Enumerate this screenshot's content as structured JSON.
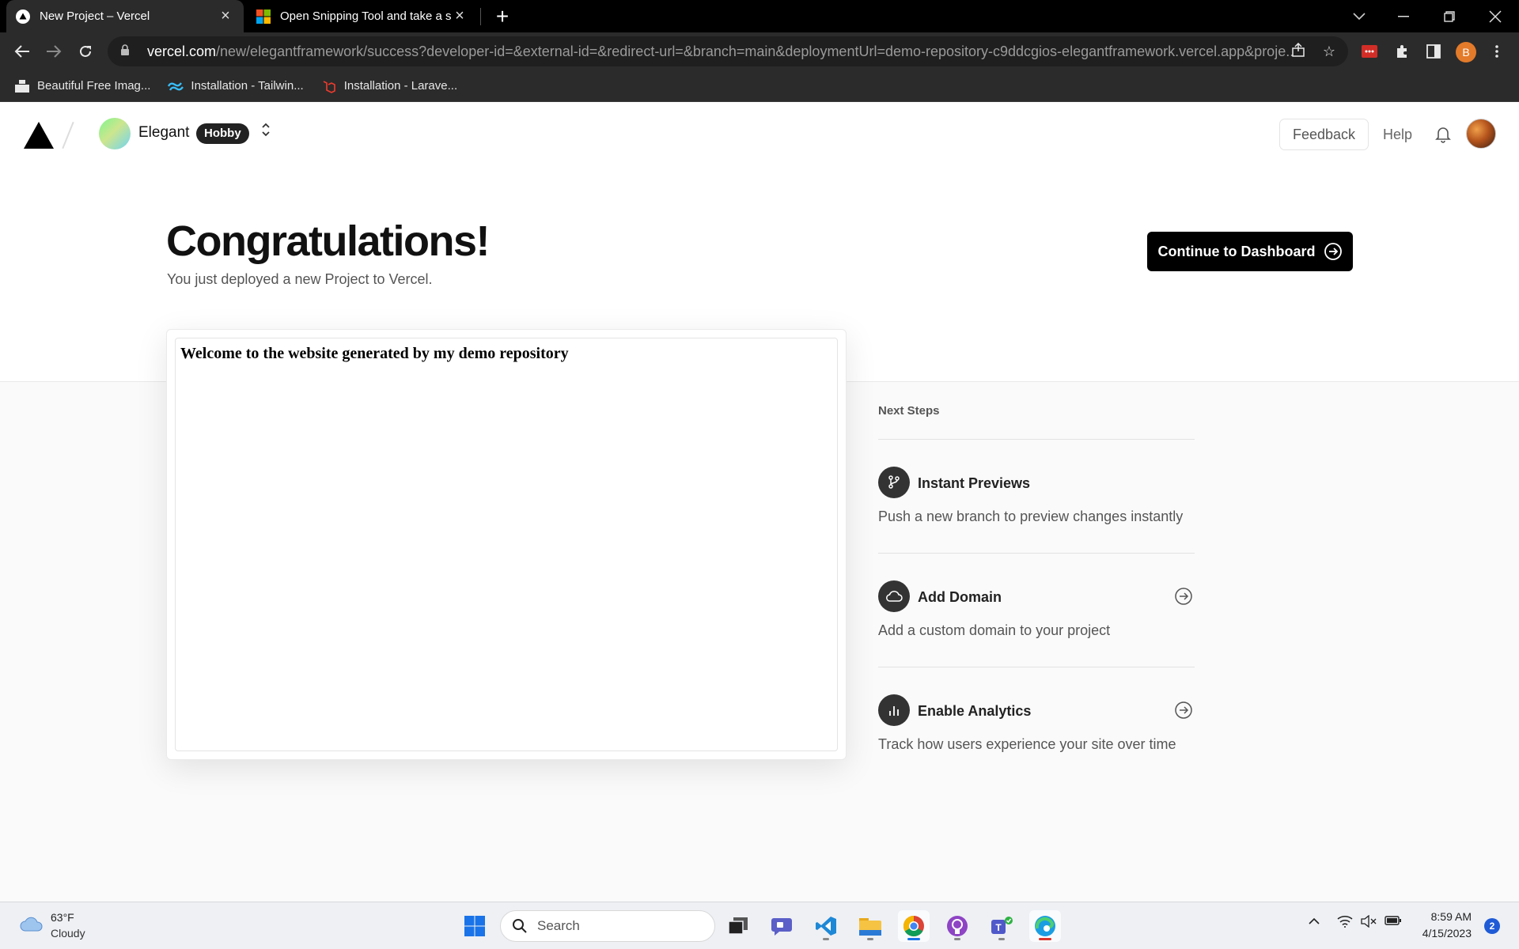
{
  "browser": {
    "tabs": [
      {
        "title": "New Project – Vercel",
        "icon": "vercel-favicon",
        "active": true
      },
      {
        "title": "Open Snipping Tool and take a sc",
        "icon": "microsoft-favicon",
        "active": false
      }
    ],
    "url_host": "vercel.com",
    "url_path": "/new/elegantframework/success?developer-id=&external-id=&redirect-url=&branch=main&deploymentUrl=demo-repository-c9ddcgios-elegantframework.vercel.app&proje...",
    "profile_initial": "B",
    "bookmarks": [
      {
        "label": "Beautiful Free Imag...",
        "icon": "unsplash-icon"
      },
      {
        "label": "Installation - Tailwin...",
        "icon": "tailwind-icon"
      },
      {
        "label": "Installation - Larave...",
        "icon": "laravel-icon"
      }
    ]
  },
  "header": {
    "team_name": "Elegant",
    "plan_badge": "Hobby",
    "feedback": "Feedback",
    "help": "Help"
  },
  "main": {
    "heading": "Congratulations!",
    "subtitle": "You just deployed a new Project to Vercel.",
    "dashboard_button": "Continue to Dashboard",
    "preview_text": "Welcome to the website generated by my demo repository"
  },
  "next_steps": {
    "title": "Next Steps",
    "items": [
      {
        "title": "Instant Previews",
        "desc": "Push a new branch to preview changes instantly",
        "icon": "git-branch-icon"
      },
      {
        "title": "Add Domain",
        "desc": "Add a custom domain to your project",
        "icon": "cloud-icon"
      },
      {
        "title": "Enable Analytics",
        "desc": "Track how users experience your site over time",
        "icon": "bar-chart-icon"
      }
    ]
  },
  "taskbar": {
    "weather_temp": "63°F",
    "weather_cond": "Cloudy",
    "search_label": "Search",
    "time": "8:59 AM",
    "date": "4/15/2023",
    "notification_count": "2"
  },
  "colors": {
    "accent": "#000000",
    "plan_badge_bg": "#222222",
    "taskbar_bg": "#eef0f4",
    "browser_chrome": "#2b2b2b"
  }
}
